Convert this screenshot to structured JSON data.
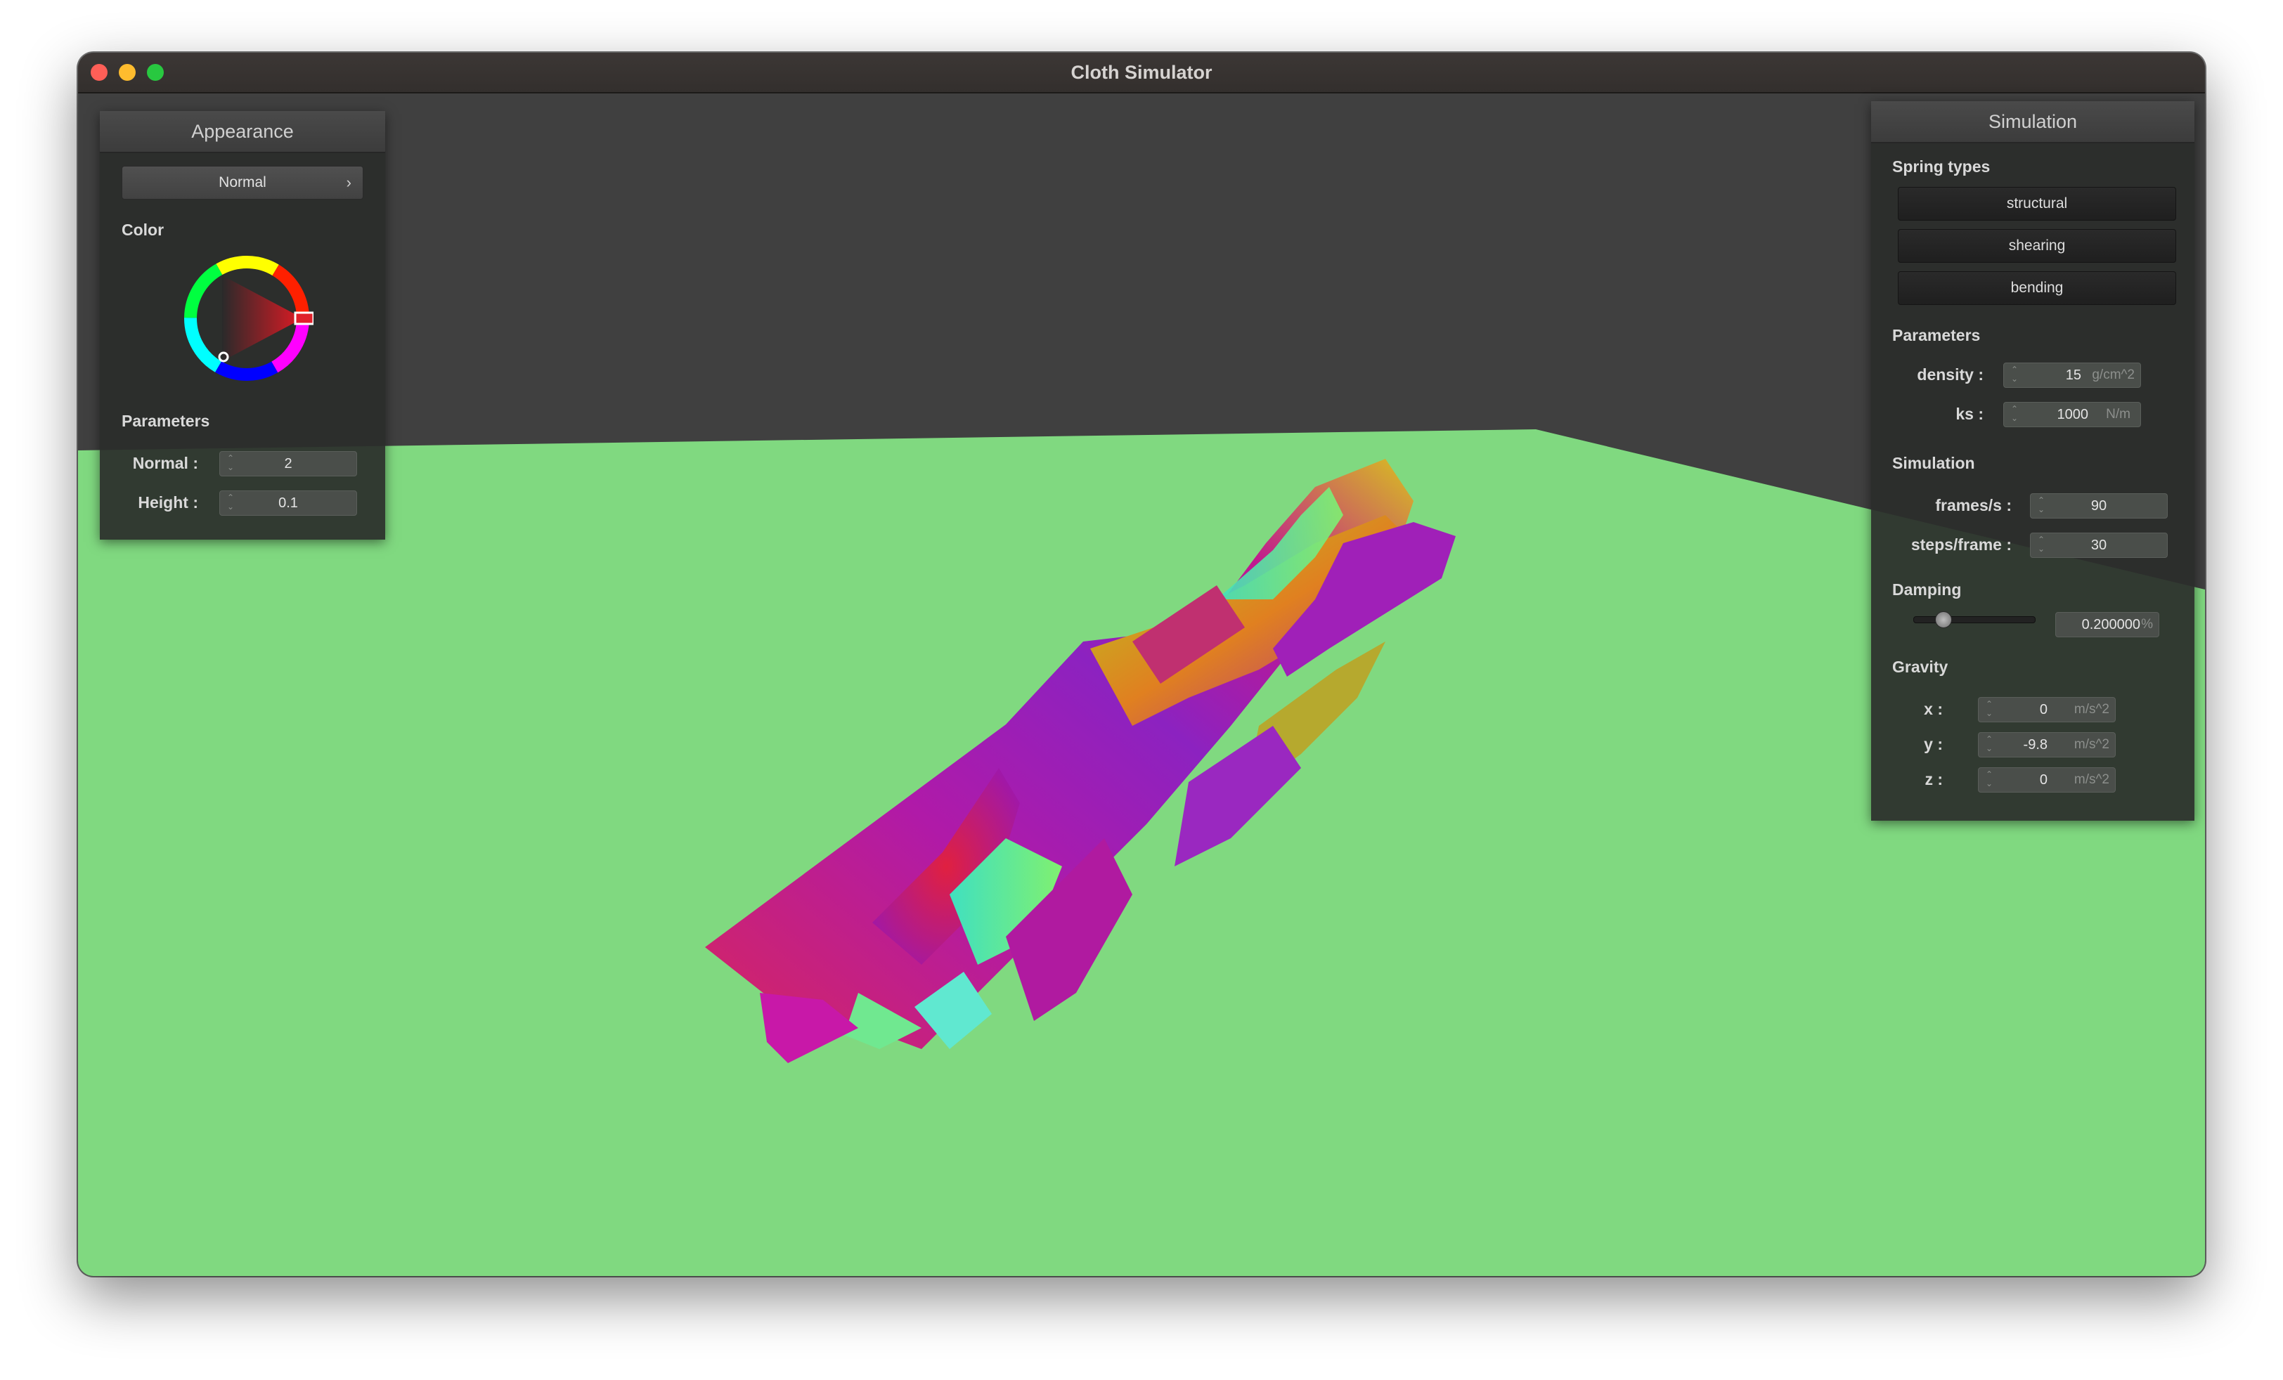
{
  "window": {
    "title": "Cloth Simulator"
  },
  "colors": {
    "sky": "#404040",
    "floor": "#80d980",
    "panel_bg": "#2a2d2a",
    "selected_color": "#e0202a"
  },
  "appearance": {
    "header": "Appearance",
    "shader": "Normal",
    "shader_chevron_icon": "chevron-right-icon",
    "color_label": "Color",
    "color_picker_icon": "color-wheel-icon",
    "parameters_label": "Parameters",
    "normal_label": "Normal :",
    "normal_value": "2",
    "height_label": "Height :",
    "height_value": "0.1"
  },
  "simulation": {
    "header": "Simulation",
    "spring_types_label": "Spring types",
    "spring_types": [
      "structural",
      "shearing",
      "bending"
    ],
    "parameters_label": "Parameters",
    "density_label": "density :",
    "density_value": "15",
    "density_unit": "g/cm^2",
    "ks_label": "ks :",
    "ks_value": "1000",
    "ks_unit": "N/m",
    "simulation_label": "Simulation",
    "fps_label": "frames/s :",
    "fps_value": "90",
    "steps_label": "steps/frame :",
    "steps_value": "30",
    "damping_label": "Damping",
    "damping_slider_level": 0.2,
    "damping_value": "0.200000",
    "damping_unit": "%",
    "gravity_label": "Gravity",
    "gx_label": "x :",
    "gx_value": "0",
    "gy_label": "y :",
    "gy_value": "-9.8",
    "gz_label": "z :",
    "gz_value": "0",
    "gravity_unit": "m/s^2"
  }
}
